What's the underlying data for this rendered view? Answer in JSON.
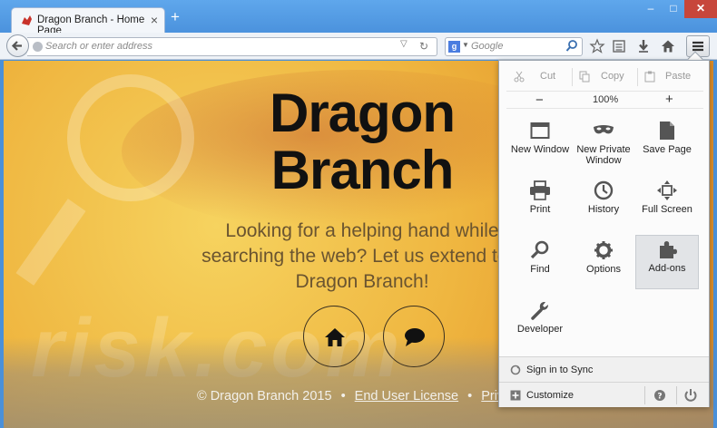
{
  "tab": {
    "title": "Dragon Branch - Home Page",
    "close": "×",
    "new_tab": "+"
  },
  "window": {
    "minimize": "–",
    "maximize": "□",
    "close": "✕"
  },
  "navbar": {
    "url_placeholder": "Search or enter address",
    "search_engine": "g",
    "search_placeholder": "Google"
  },
  "page": {
    "title_line1": "Dragon",
    "title_line2": "Branch",
    "tagline": "Looking for a helping hand while searching the web? Let us extend to y Dragon Branch!",
    "watermark": "risk.com",
    "footer_copyright": "© Dragon Branch 2015",
    "footer_link1": "End User License",
    "footer_link2": "Privacy Po",
    "footer_sep": "•",
    "colors": {
      "background": "#efb640",
      "heading": "#111111",
      "tagline": "#6a5430"
    }
  },
  "menu": {
    "edit": {
      "cut": "Cut",
      "copy": "Copy",
      "paste": "Paste"
    },
    "zoom": {
      "minus": "−",
      "level": "100%",
      "plus": "+"
    },
    "items": [
      {
        "label": "New Window",
        "icon": "new-window-icon"
      },
      {
        "label": "New Private Window",
        "icon": "private-mask-icon"
      },
      {
        "label": "Save Page",
        "icon": "save-page-icon"
      },
      {
        "label": "Print",
        "icon": "printer-icon"
      },
      {
        "label": "History",
        "icon": "history-clock-icon"
      },
      {
        "label": "Full Screen",
        "icon": "fullscreen-icon"
      },
      {
        "label": "Find",
        "icon": "find-magnifier-icon"
      },
      {
        "label": "Options",
        "icon": "options-gear-icon"
      },
      {
        "label": "Add-ons",
        "icon": "addons-puzzle-icon"
      },
      {
        "label": "Developer",
        "icon": "developer-wrench-icon"
      }
    ],
    "sync": "Sign in to Sync",
    "customize": "Customize"
  }
}
